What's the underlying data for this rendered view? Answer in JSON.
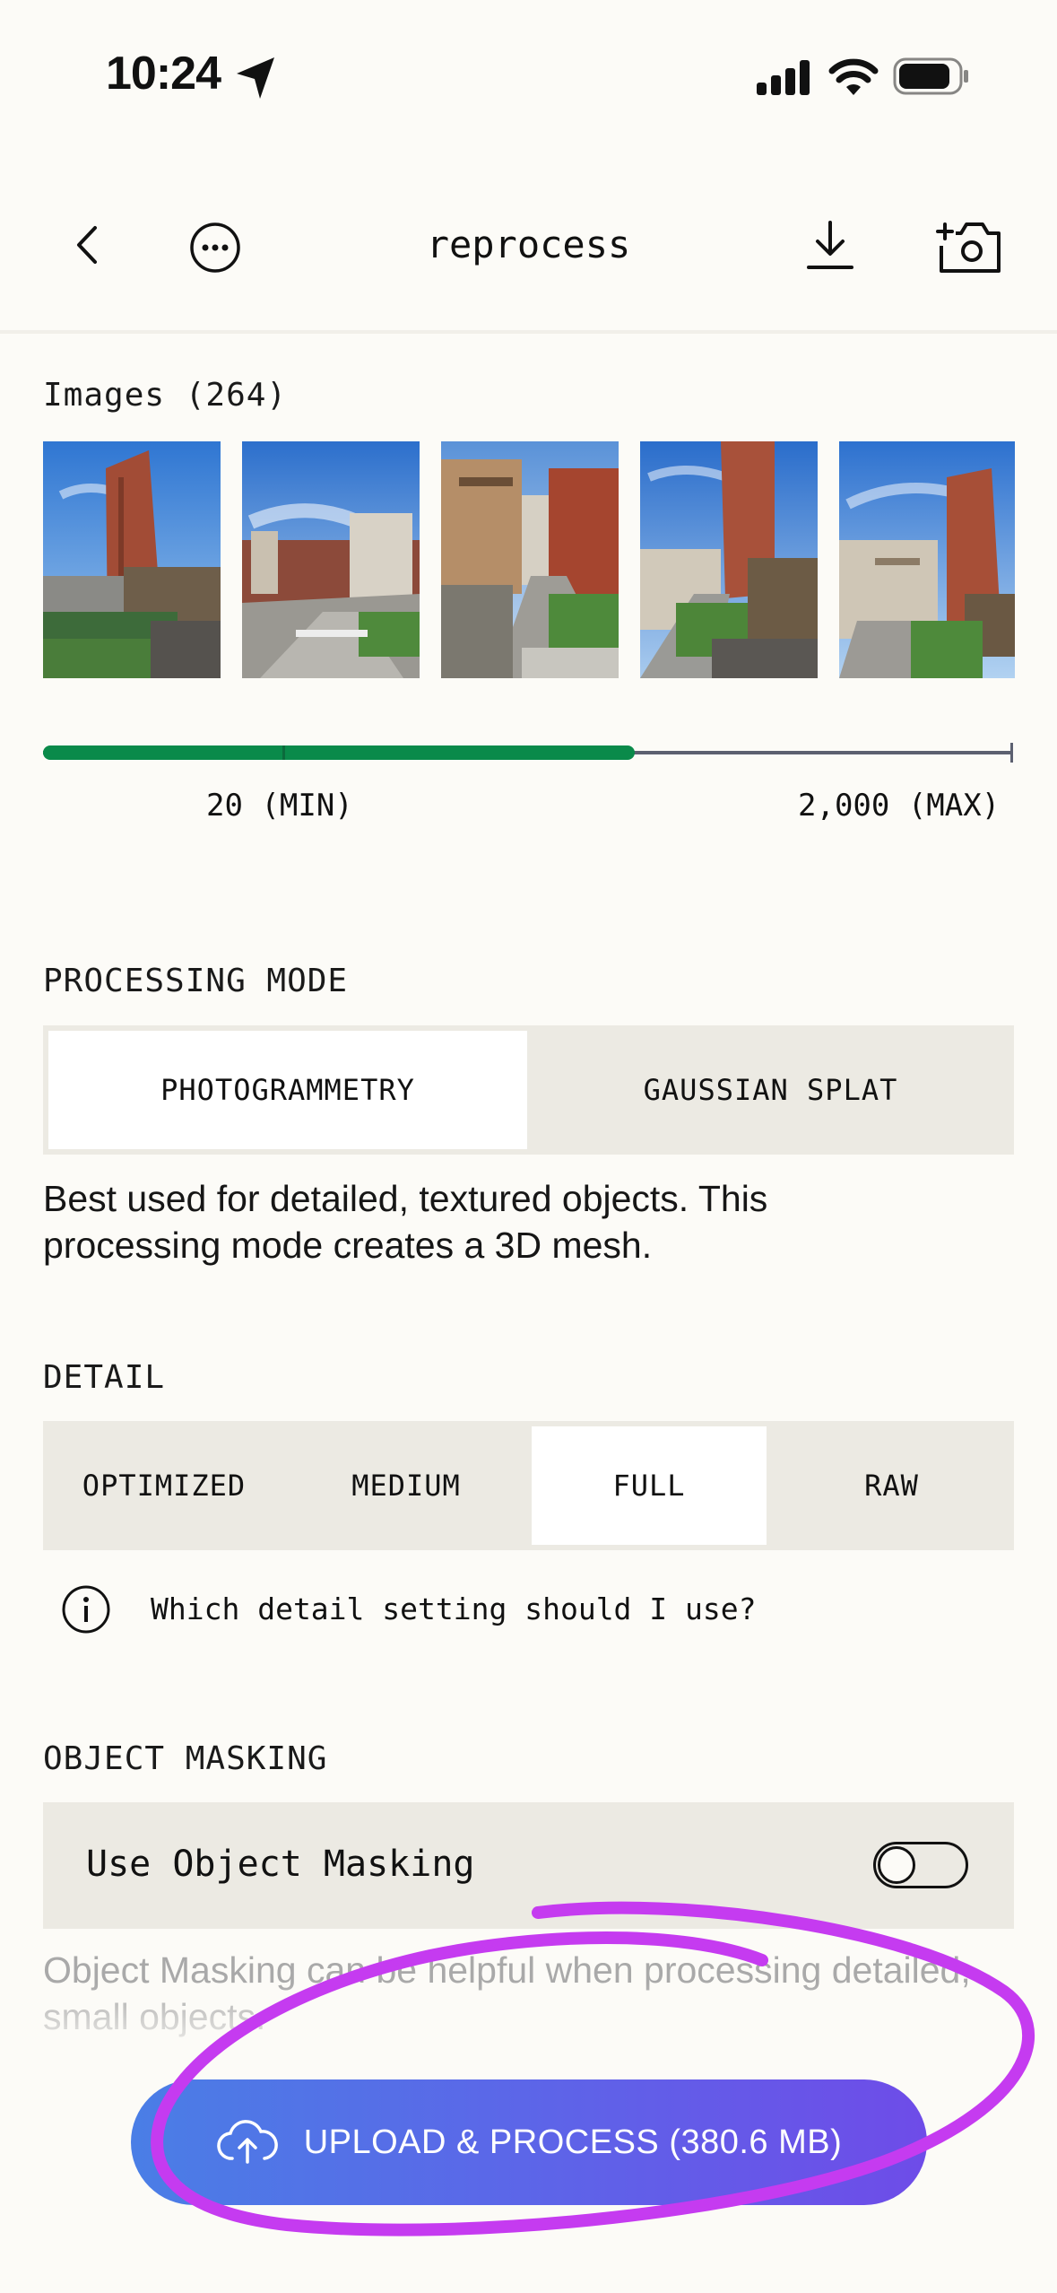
{
  "status": {
    "time": "10:24"
  },
  "nav": {
    "title": "reprocess"
  },
  "images": {
    "label": "Images (264)",
    "thumbs": [
      "photo-1",
      "photo-2",
      "photo-3",
      "photo-4",
      "photo-5"
    ]
  },
  "slider": {
    "min_label": "20 (MIN)",
    "max_label": "2,000 (MAX)",
    "fill_fraction": 0.61
  },
  "processing": {
    "label": "PROCESSING MODE",
    "options": [
      "PHOTOGRAMMETRY",
      "GAUSSIAN SPLAT"
    ],
    "selected": "PHOTOGRAMMETRY",
    "description": "Best used for detailed, textured objects. This processing mode creates a 3D mesh."
  },
  "detail": {
    "label": "DETAIL",
    "options": [
      "OPTIMIZED",
      "MEDIUM",
      "FULL",
      "RAW"
    ],
    "selected": "FULL",
    "help": "Which detail setting should I use?"
  },
  "masking": {
    "label": "OBJECT MASKING",
    "toggle_label": "Use Object Masking",
    "enabled": false,
    "description": "Object Masking can be helpful when processing detailed, small objects."
  },
  "cta": {
    "label": "UPLOAD & PROCESS (380.6 MB)"
  },
  "colors": {
    "accent_green": "#0A8A4A",
    "cta_start": "#4A7EE6",
    "cta_end": "#6E4CE8",
    "annotation": "#C53BF0"
  }
}
